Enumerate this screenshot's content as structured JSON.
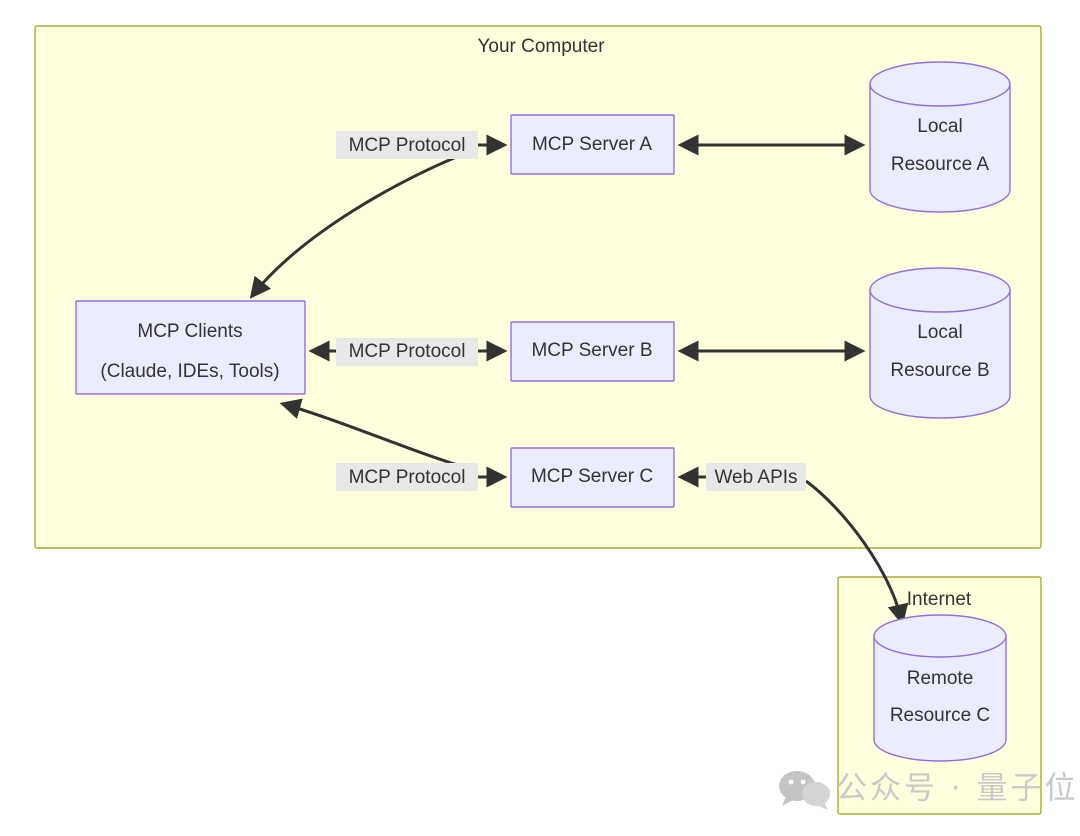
{
  "diagram": {
    "type": "flowchart",
    "subgraphs": [
      {
        "id": "your-computer",
        "title": "Your Computer"
      },
      {
        "id": "internet",
        "title": "Internet"
      }
    ],
    "nodes": [
      {
        "id": "mcp-clients",
        "shape": "rect",
        "line1": "MCP Clients",
        "line2": "(Claude, IDEs, Tools)"
      },
      {
        "id": "mcp-server-a",
        "shape": "rect",
        "line1": "MCP Server A",
        "line2": ""
      },
      {
        "id": "mcp-server-b",
        "shape": "rect",
        "line1": "MCP Server B",
        "line2": ""
      },
      {
        "id": "mcp-server-c",
        "shape": "rect",
        "line1": "MCP Server C",
        "line2": ""
      },
      {
        "id": "local-resource-a",
        "shape": "cylinder",
        "line1": "Local",
        "line2": "Resource A"
      },
      {
        "id": "local-resource-b",
        "shape": "cylinder",
        "line1": "Local",
        "line2": "Resource B"
      },
      {
        "id": "remote-resource-c",
        "shape": "cylinder",
        "line1": "Remote",
        "line2": "Resource C"
      }
    ],
    "edges": [
      {
        "id": "clients-server-a",
        "label": "MCP Protocol",
        "from": "mcp-clients",
        "to": "mcp-server-a"
      },
      {
        "id": "clients-server-b",
        "label": "MCP Protocol",
        "from": "mcp-clients",
        "to": "mcp-server-b"
      },
      {
        "id": "clients-server-c",
        "label": "MCP Protocol",
        "from": "mcp-clients",
        "to": "mcp-server-c"
      },
      {
        "id": "server-a-resource-a",
        "label": "",
        "from": "mcp-server-a",
        "to": "local-resource-a"
      },
      {
        "id": "server-b-resource-b",
        "label": "",
        "from": "mcp-server-b",
        "to": "local-resource-b"
      },
      {
        "id": "server-c-web-apis",
        "label": "Web APIs",
        "from": "remote-resource-c",
        "to": "mcp-server-c"
      }
    ],
    "colors": {
      "subgraph_fill": "#FFFFDE",
      "subgraph_border": "#AAAA33",
      "node_fill": "#ECECFF",
      "node_border": "#9370DB",
      "edge_stroke": "#333333",
      "label_chip": "#E8E8E8",
      "text": "#333333"
    }
  },
  "watermark": {
    "text": "公众号 · 量子位",
    "icon": "wechat-icon"
  }
}
